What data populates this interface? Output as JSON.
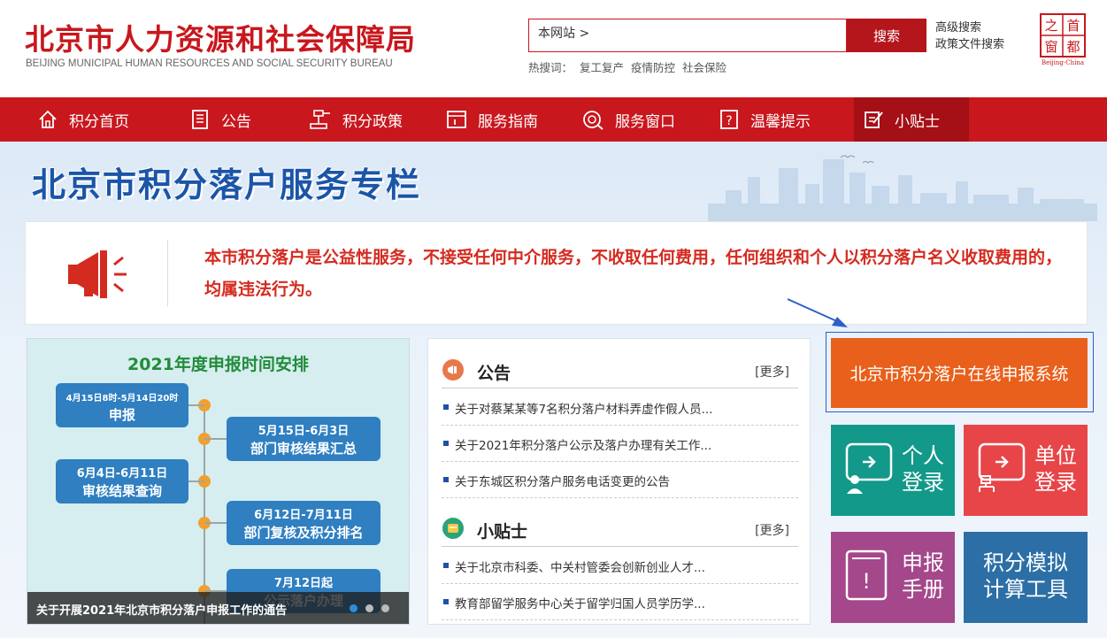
{
  "header": {
    "title_cn": "北京市人力资源和社会保障局",
    "title_en": "BEIJING MUNICIPAL HUMAN RESOURCES AND SOCIAL SECURITY BUREAU",
    "search": {
      "scope": "本网站 >",
      "button": "搜索"
    },
    "advanced_search": "高级搜索",
    "policy_search": "政策文件搜索",
    "hot_label": "热搜词：",
    "hot_words": [
      "复工复产",
      "疫情防控",
      "社会保险"
    ],
    "capital_logo": [
      "之",
      "首",
      "窗",
      "都"
    ],
    "capital_logo_en": "Beijing-China"
  },
  "nav": {
    "items": [
      {
        "label": "积分首页",
        "icon": "home-icon"
      },
      {
        "label": "公告",
        "icon": "document-icon"
      },
      {
        "label": "积分政策",
        "icon": "gavel-icon"
      },
      {
        "label": "服务指南",
        "icon": "guide-icon"
      },
      {
        "label": "服务窗口",
        "icon": "service-window-icon"
      },
      {
        "label": "温馨提示",
        "icon": "tip-icon"
      },
      {
        "label": "小贴士",
        "icon": "edit-note-icon"
      }
    ],
    "active_index": 6
  },
  "banner": {
    "title": "北京市积分落户服务专栏"
  },
  "notice": {
    "text": "本市积分落户是公益性服务，不接受任何中介服务，不收取任何费用，任何组织和个人以积分落户名义收取费用的，均属违法行为。"
  },
  "slider": {
    "title": "2021年度申报时间安排",
    "steps": [
      {
        "date": "4月15日8时-5月14日20时",
        "label": "申报"
      },
      {
        "date": "5月15日-6月3日",
        "label": "部门审核结果汇总"
      },
      {
        "date": "6月4日-6月11日",
        "label": "审核结果查询"
      },
      {
        "date": "6月12日-7月11日",
        "label": "部门复核及积分排名"
      },
      {
        "date": "7月12日起",
        "label": "公示落户办理"
      }
    ],
    "caption": "关于开展2021年北京市积分落户申报工作的通告",
    "dots": 3,
    "active_dot": 0
  },
  "announcements": {
    "title": "公告",
    "more": "[更多]",
    "items": [
      "关于对蔡某某等7名积分落户材料弄虚作假人员...",
      "关于2021年积分落户公示及落户办理有关工作...",
      "关于东城区积分落户服务电话变更的公告"
    ]
  },
  "tips": {
    "title": "小贴士",
    "more": "[更多]",
    "items": [
      "关于北京市科委、中关村管委会创新创业人才...",
      "教育部留学服务中心关于留学归国人员学历学..."
    ]
  },
  "quick": {
    "apply": "北京市积分落户在线申报系统",
    "personal_login": [
      "个人",
      "登录"
    ],
    "unit_login": [
      "单位",
      "登录"
    ],
    "manual": [
      "申报",
      "手册"
    ],
    "calculator": [
      "积分模拟",
      "计算工具"
    ]
  },
  "colors": {
    "brand_red": "#c8171d",
    "banner_blue": "#1a55a8",
    "apply_orange": "#e8601b",
    "tile_teal": "#12998a",
    "tile_red": "#e84549",
    "tile_purple": "#a4478b",
    "tile_blue": "#2c6fa6"
  }
}
